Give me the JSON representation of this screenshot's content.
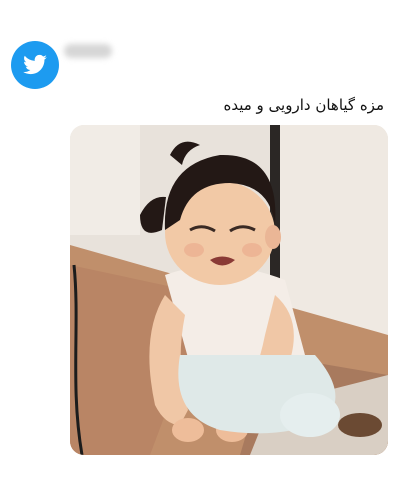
{
  "tweet": {
    "platform_icon": "twitter-bird-icon",
    "brand_color": "#1d9bf0",
    "username": "",
    "text": "مزه گیاهان دارویی و میده"
  },
  "media": {
    "icon": "crying-toddler-photo"
  }
}
